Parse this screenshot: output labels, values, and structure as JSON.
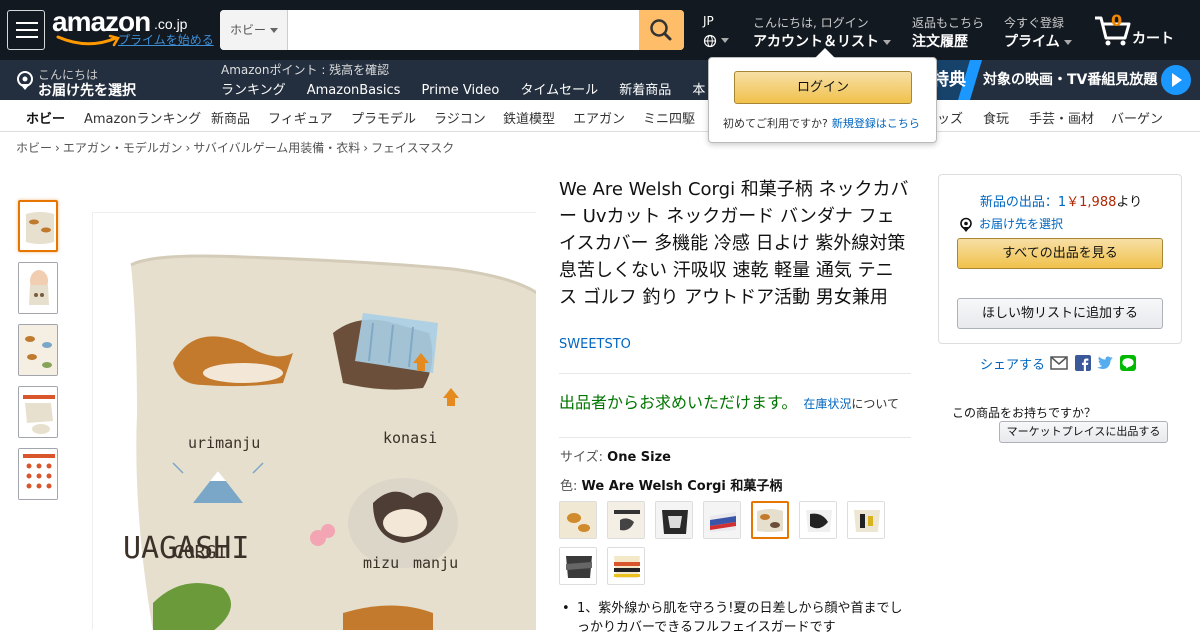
{
  "nav": {
    "logo_text": "amazon",
    "logo_tld": ".co.jp",
    "prime_link": "プライムを始める",
    "search_category": "ホビー",
    "search_placeholder": "",
    "lang_code": "JP",
    "account_line1": "こんにちは, ログイン",
    "account_line2": "アカウント＆リスト",
    "orders_line1": "返品もこちら",
    "orders_line2": "注文履歴",
    "prime_line1": "今すぐ登録",
    "prime_line2": "プライム",
    "cart_count": "0",
    "cart_label": "カート"
  },
  "subnav": {
    "deliver_line1": "こんにちは",
    "deliver_line2": "お届け先を選択",
    "points_text": "Amazonポイント : 残高を確認",
    "links": [
      "ランキング",
      "AmazonBasics",
      "Prime Video",
      "タイムセール",
      "新着商品",
      "本"
    ],
    "promo_tab": "特典",
    "promo_text": "対象の映画・TV番組見放題"
  },
  "categories": [
    "ホビー",
    "Amazonランキング",
    "新商品",
    "フィギュア",
    "プラモデル",
    "ラジコン",
    "鉄道模型",
    "エアガン",
    "ミニ四駆",
    "ッズ",
    "食玩",
    "手芸・画材",
    "バーゲン"
  ],
  "login_popover": {
    "button": "ログイン",
    "first_time": "初めてご利用ですか?",
    "register": "新規登録はこちら"
  },
  "breadcrumb": [
    "ホビー",
    "エアガン・モデルガン",
    "サバイバルゲーム用装備・衣料",
    "フェイスマスク"
  ],
  "product": {
    "title": "We Are Welsh Corgi 和菓子柄 ネックカバー Uvカット ネックガード バンダナ フェイスカバー 多機能 冷感 日よけ 紫外線対策 息苦しくない 汗吸収 速乾 軽量 通気 テニス ゴルフ 釣り アウトドア活動 男女兼用",
    "brand": "SWEETSTO",
    "availability": "出品者からお求めいただけます。",
    "stock_link": "在庫状況",
    "stock_suffix": "について",
    "size_label": "サイズ:",
    "size_value": "One Size",
    "color_label": "色:",
    "color_value": "We Are Welsh Corgi 和菓子柄",
    "bullet1": "1、紫外線から肌を守ろう!夏の日差しから顔や首までしっかりカバーできるフルフェイスガードです",
    "image_texts": [
      "urimanju",
      "konasi",
      "UAGASHI",
      "CORGI",
      "mizu",
      "manju"
    ]
  },
  "buybox": {
    "new_offers": "新品の出品：1",
    "price": "￥1,988",
    "yori": "より",
    "deliver": "お届け先を選択",
    "see_all": "すべての出品を見る",
    "wishlist": "ほしい物リストに追加する"
  },
  "share": {
    "label": "シェアする",
    "icons": [
      "email-icon",
      "facebook-icon",
      "twitter-icon",
      "line-icon"
    ]
  },
  "sell": {
    "question": "この商品をお持ちですか？",
    "button": "マーケットプレイスに出品する"
  },
  "colors": {
    "nav_bg": "#131921",
    "subnav_bg": "#232f3e",
    "accent_orange": "#febd69",
    "link_blue": "#0066c0",
    "price_red": "#b12704",
    "avail_green": "#007600"
  }
}
